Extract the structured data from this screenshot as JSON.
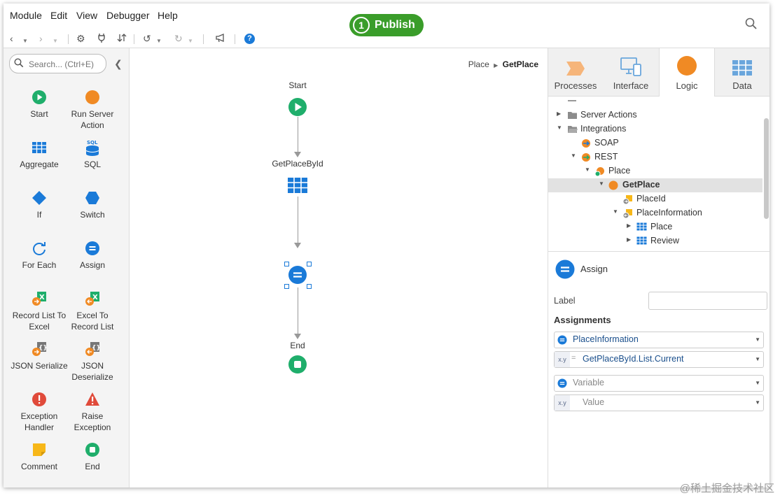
{
  "menu": [
    "Module",
    "Edit",
    "View",
    "Debugger",
    "Help"
  ],
  "publish": {
    "number": "1",
    "label": "Publish"
  },
  "toolbox": {
    "search_placeholder": "Search... (Ctrl+E)",
    "tools": [
      {
        "label": "Start",
        "icon": "start-icon"
      },
      {
        "label": "Run Server Action",
        "icon": "run-server-action-icon"
      },
      {
        "label": "Aggregate",
        "icon": "aggregate-icon"
      },
      {
        "label": "SQL",
        "icon": "sql-icon"
      },
      {
        "label": "If",
        "icon": "if-icon"
      },
      {
        "label": "Switch",
        "icon": "switch-icon"
      },
      {
        "label": "For Each",
        "icon": "for-each-icon"
      },
      {
        "label": "Assign",
        "icon": "assign-icon"
      },
      {
        "label": "Record List To Excel",
        "icon": "record-list-to-excel-icon"
      },
      {
        "label": "Excel To Record List",
        "icon": "excel-to-record-list-icon"
      },
      {
        "label": "JSON Serialize",
        "icon": "json-serialize-icon"
      },
      {
        "label": "JSON Deserialize",
        "icon": "json-deserialize-icon"
      },
      {
        "label": "Exception Handler",
        "icon": "exception-handler-icon"
      },
      {
        "label": "Raise Exception",
        "icon": "raise-exception-icon"
      },
      {
        "label": "Comment",
        "icon": "comment-icon"
      },
      {
        "label": "End",
        "icon": "end-icon"
      }
    ]
  },
  "canvas": {
    "breadcrumb": {
      "parent": "Place",
      "current": "GetPlace"
    },
    "nodes": {
      "start": "Start",
      "aggregate": "GetPlaceById",
      "end": "End"
    }
  },
  "tabs": [
    "Processes",
    "Interface",
    "Logic",
    "Data"
  ],
  "tree": [
    {
      "label": "Server Actions"
    },
    {
      "label": "Integrations"
    },
    {
      "label": "SOAP"
    },
    {
      "label": "REST"
    },
    {
      "label": "Place"
    },
    {
      "label": "GetPlace"
    },
    {
      "label": "PlaceId"
    },
    {
      "label": "PlaceInformation"
    },
    {
      "label": "Place"
    },
    {
      "label": "Review"
    }
  ],
  "properties": {
    "title": "Assign",
    "label_caption": "Label",
    "label_value": "",
    "assignments_title": "Assignments",
    "fields": [
      {
        "value": "PlaceInformation"
      },
      {
        "value": "GetPlaceById.List.Current"
      },
      {
        "value": "Variable"
      },
      {
        "value": "Value"
      }
    ],
    "xy": "x.y",
    "eq": "="
  },
  "watermark": "@稀土掘金技术社区",
  "colors": {
    "publish": "#3a9d2a",
    "flow_green": "#1fae6b",
    "flow_blue": "#1a7ad8",
    "logic_orange": "#f08a24",
    "selected_row": "#e2e2e2"
  }
}
